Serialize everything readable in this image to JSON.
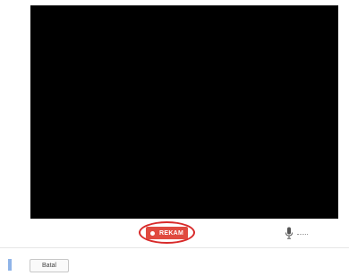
{
  "recorder": {
    "record_label": "REKAM",
    "record_color": "#e04a3f",
    "highlight_color": "#d82a2a",
    "mic_icon": "microphone-icon"
  },
  "footer": {
    "cancel_label": "Batal",
    "accent_color": "#8fb4e8"
  }
}
